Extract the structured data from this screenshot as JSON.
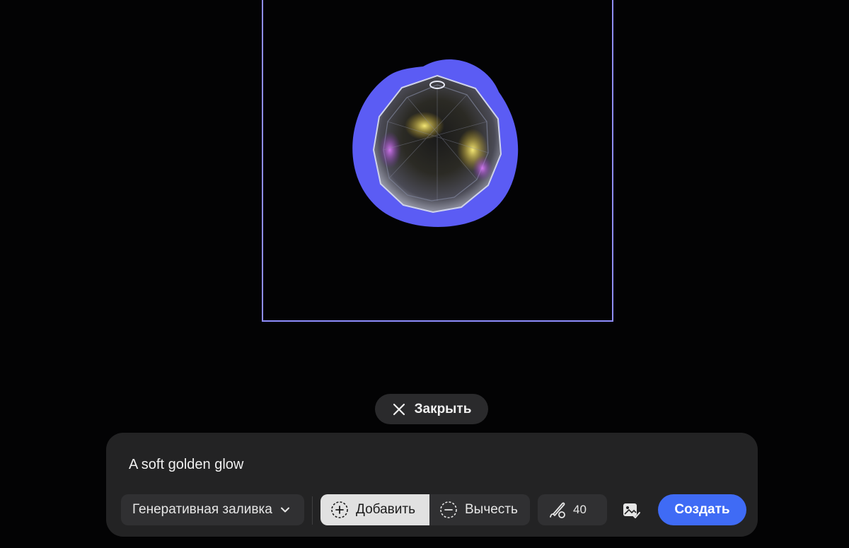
{
  "close_button": {
    "label": "Закрыть",
    "icon": "close-icon"
  },
  "prompt": {
    "value": "A soft golden glow"
  },
  "toolbar": {
    "mode_label": "Генеративная заливка",
    "add_label": "Добавить",
    "subtract_label": "Вычесть",
    "brush_size": "40",
    "create_label": "Создать"
  },
  "colors": {
    "accent": "#3f6bf5",
    "selection": "#5b5cf4",
    "frame": "#8f8dff",
    "background": "#030304",
    "panel": "#232324"
  }
}
